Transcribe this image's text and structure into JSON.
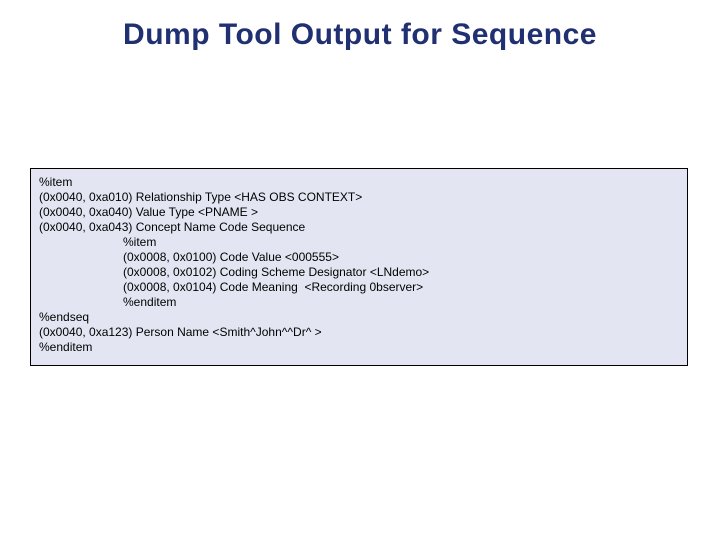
{
  "title": "Dump Tool Output for Sequence",
  "code": {
    "l1": "%item",
    "l2": "(0x0040, 0xa010) Relationship Type <HAS OBS CONTEXT>",
    "l3": "(0x0040, 0xa040) Value Type <PNAME >",
    "l4": "(0x0040, 0xa043) Concept Name Code Sequence",
    "l5": "%item",
    "l6": "(0x0008, 0x0100) Code Value <000555>",
    "l7": "(0x0008, 0x0102) Coding Scheme Designator <LNdemo>",
    "l8": "(0x0008, 0x0104) Code Meaning  <Recording 0bserver>",
    "l9": "%enditem",
    "l10": "%endseq",
    "l11": "(0x0040, 0xa123) Person Name <Smith^John^^Dr^ >",
    "l12": "%enditem"
  }
}
